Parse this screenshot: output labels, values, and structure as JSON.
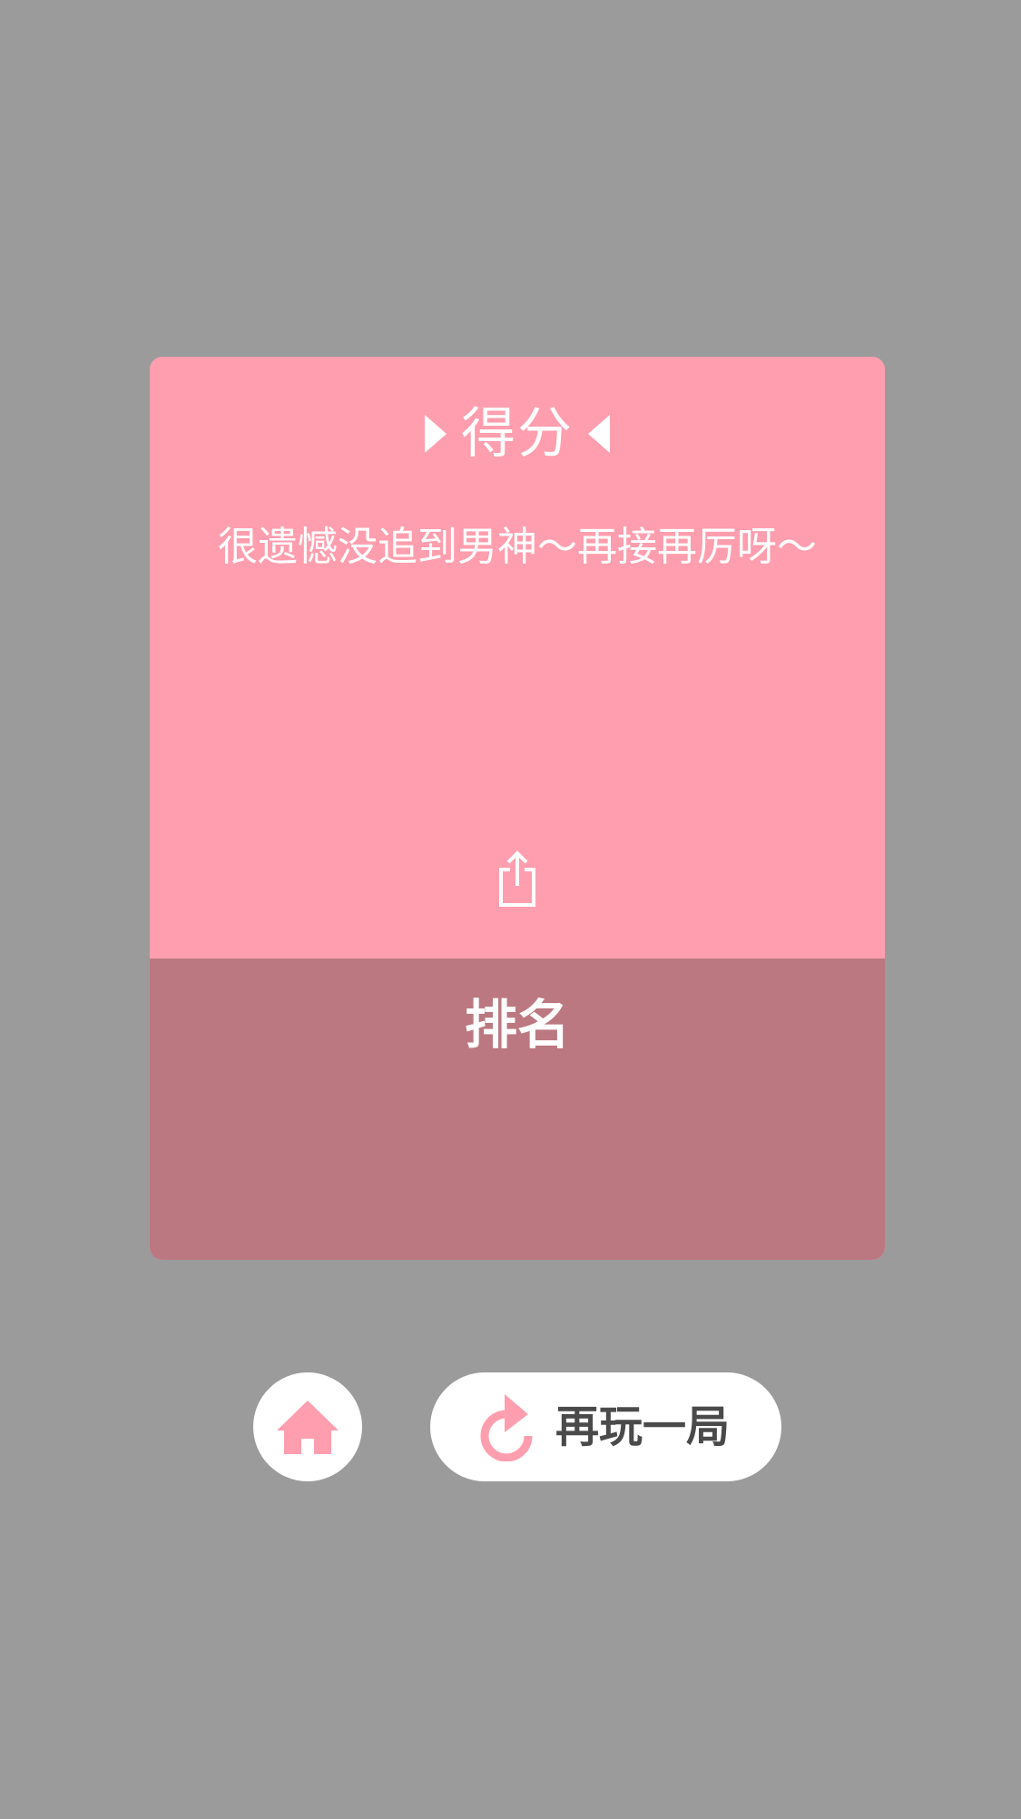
{
  "score": {
    "title": "得分",
    "message": "很遗憾没追到男神～再接再厉呀～",
    "share_icon": "share-icon"
  },
  "rank": {
    "title": "排名"
  },
  "actions": {
    "home_icon": "home-icon",
    "replay_icon": "refresh-icon",
    "replay_label": "再玩一局"
  },
  "colors": {
    "background": "#9b9b9b",
    "score_panel": "#ff9eae",
    "rank_panel": "#bc7880",
    "accent_pink": "#ff9eae",
    "button_text": "#4a4a4a",
    "white": "#ffffff"
  }
}
